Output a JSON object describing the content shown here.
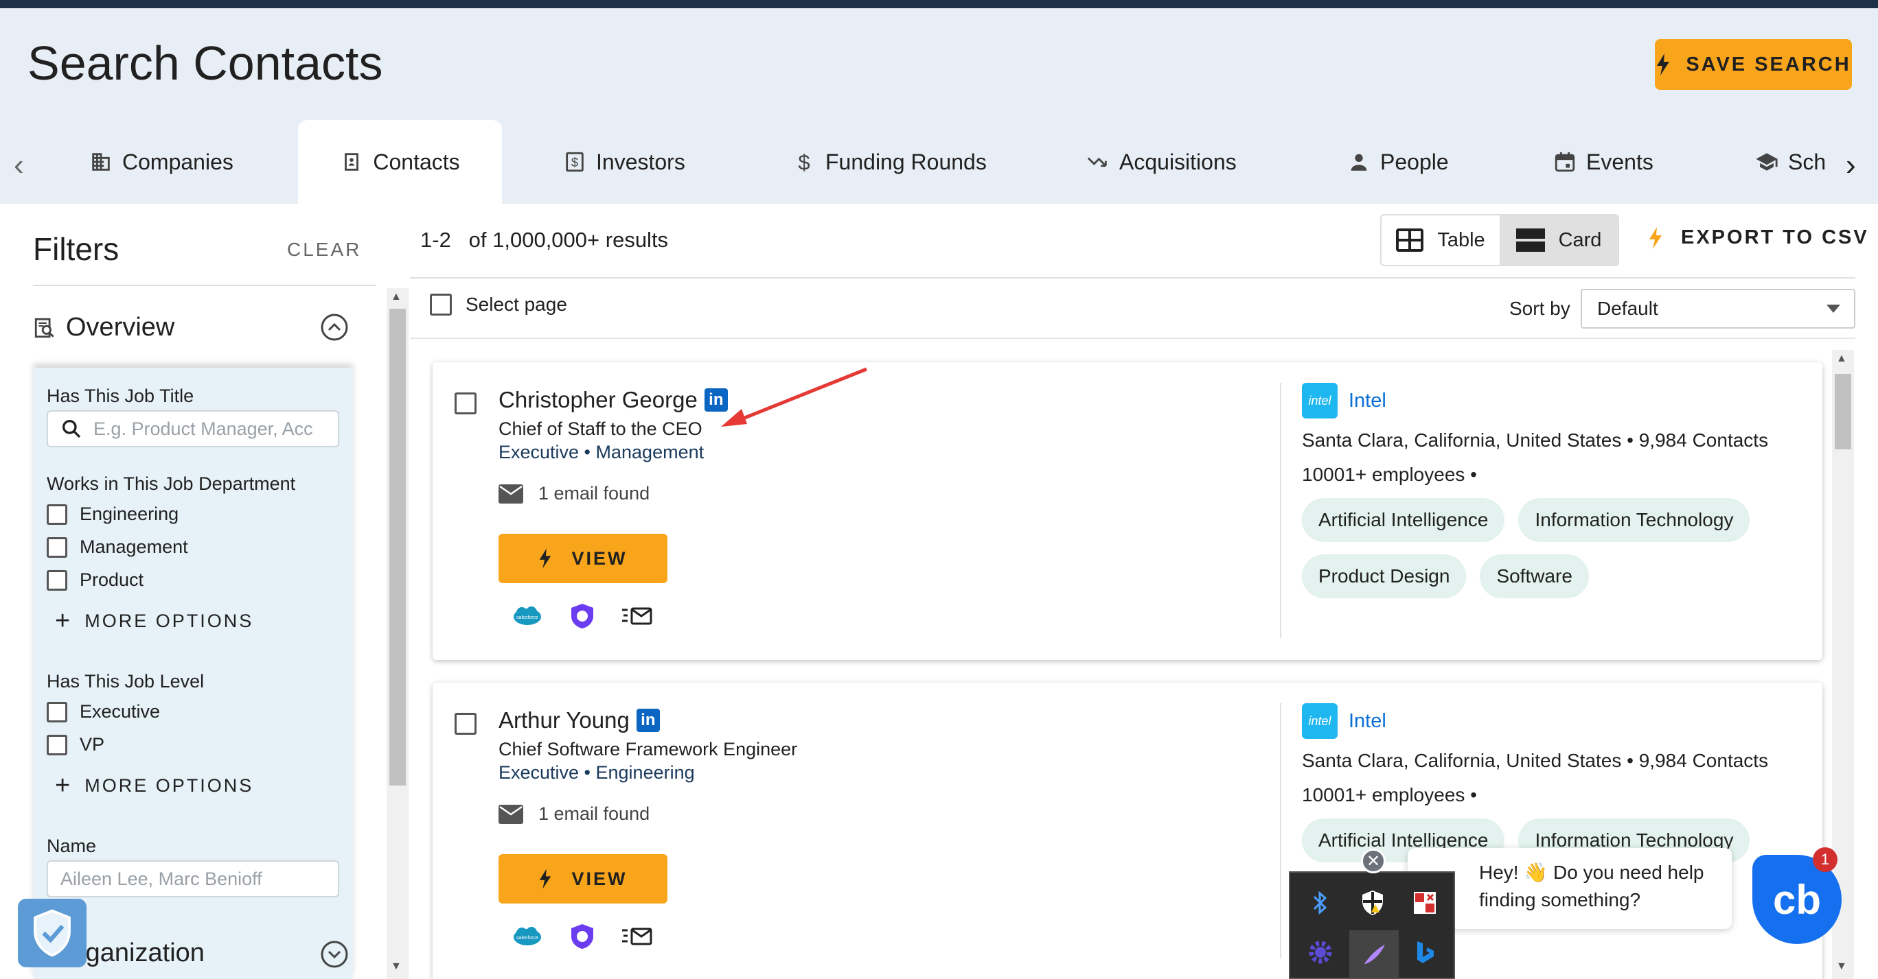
{
  "header": {
    "title": "Search Contacts",
    "save_search_label": "SAVE SEARCH"
  },
  "tabs": [
    {
      "label": "Companies",
      "icon": "building-icon"
    },
    {
      "label": "Contacts",
      "icon": "contact-card-icon",
      "active": true
    },
    {
      "label": "Investors",
      "icon": "dollar-box-icon"
    },
    {
      "label": "Funding Rounds",
      "icon": "dollar-icon"
    },
    {
      "label": "Acquisitions",
      "icon": "merge-arrow-icon"
    },
    {
      "label": "People",
      "icon": "person-icon"
    },
    {
      "label": "Events",
      "icon": "calendar-icon"
    },
    {
      "label": "Sch",
      "icon": "school-icon"
    }
  ],
  "filters": {
    "title": "Filters",
    "clear_label": "CLEAR",
    "overview_label": "Overview",
    "job_title_label": "Has This Job Title",
    "job_title_placeholder": "E.g. Product Manager, Acc",
    "department_label": "Works in This Job Department",
    "departments": [
      "Engineering",
      "Management",
      "Product"
    ],
    "more_options_label": "MORE OPTIONS",
    "job_level_label": "Has This Job Level",
    "job_levels": [
      "Executive",
      "VP"
    ],
    "name_label": "Name",
    "name_placeholder": "Aileen Lee, Marc Benioff",
    "organization_label": "rganization"
  },
  "results": {
    "range": "1-2",
    "count_text": "of 1,000,000+ results",
    "view_table_label": "Table",
    "view_card_label": "Card",
    "export_label": "EXPORT TO CSV",
    "select_page_label": "Select page",
    "sort_label": "Sort by",
    "sort_value": "Default"
  },
  "contacts": [
    {
      "name": "Christopher George",
      "title": "Chief of Staff to the CEO",
      "levels": "Executive • Management",
      "email_text": "1 email found",
      "view_label": "VIEW",
      "company": {
        "name": "Intel",
        "logo_text": "intel",
        "location": "Santa Clara, California, United States",
        "contacts": "9,984 Contacts",
        "employees": "10001+ employees •",
        "tags": [
          "Artificial Intelligence",
          "Information Technology",
          "Product Design",
          "Software"
        ]
      }
    },
    {
      "name": "Arthur Young",
      "title": "Chief Software Framework Engineer",
      "levels": "Executive • Engineering",
      "email_text": "1 email found",
      "view_label": "VIEW",
      "company": {
        "name": "Intel",
        "logo_text": "intel",
        "location": "Santa Clara, California, United States",
        "contacts": "9,984 Contacts",
        "employees": "10001+ employees •",
        "tags": [
          "Artificial Intelligence",
          "Information Technology"
        ]
      }
    }
  ],
  "chat": {
    "message": "Hey! 👋 Do you need help finding something?",
    "button_text": "cb",
    "badge_count": "1"
  },
  "colors": {
    "accent": "#f9a51c",
    "header_bg": "#e8eef5",
    "topbar": "#1c3145",
    "link": "#0b6fd6",
    "chip_bg": "#e3f2ee",
    "annotation_arrow": "#e53935"
  }
}
